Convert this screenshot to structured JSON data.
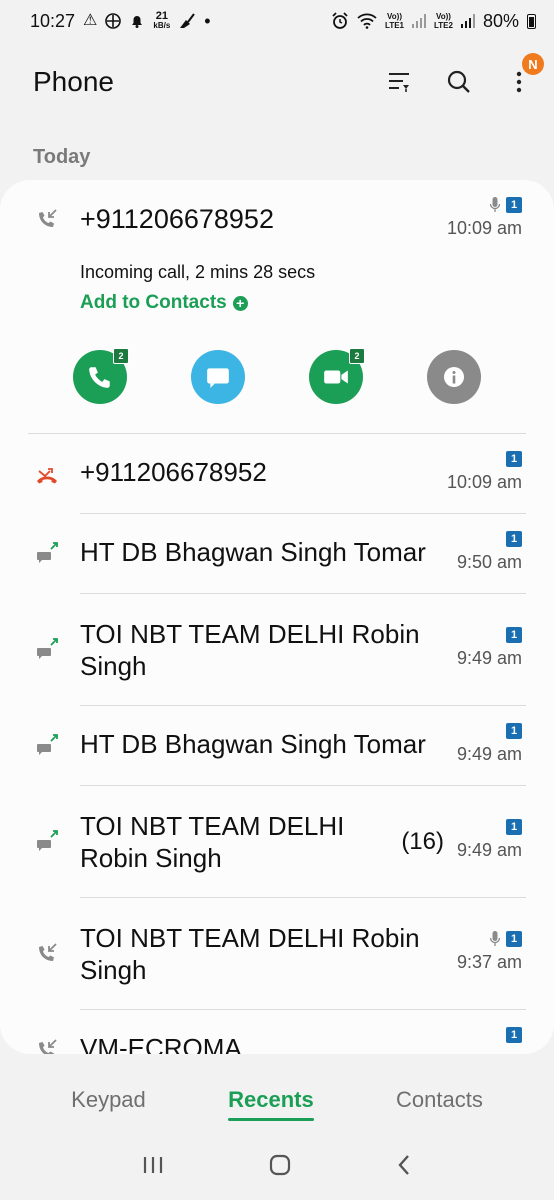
{
  "status_bar": {
    "time": "10:27",
    "net_speed_value": "21",
    "net_speed_unit": "kB/s",
    "dot": "•",
    "volte1_top": "Vo))",
    "volte1_bottom": "LTE1",
    "volte2_top": "Vo))",
    "volte2_bottom": "LTE2",
    "battery": "80%"
  },
  "app_bar": {
    "title": "Phone",
    "menu_badge": "N"
  },
  "section": {
    "label": "Today"
  },
  "expanded_call": {
    "number": "+911206678952",
    "time": "10:09 am",
    "sim": "1",
    "detail": "Incoming call, 2 mins 28 secs",
    "add_to_contacts": "Add to Contacts",
    "actions": {
      "call_count": "2",
      "video_count": "2"
    }
  },
  "calls": [
    {
      "name": "+911206678952",
      "time": "10:09 am",
      "sim": "1",
      "type": "missed"
    },
    {
      "name": "HT DB Bhagwan Singh Tomar",
      "time": "9:50 am",
      "sim": "1",
      "type": "outgoing-message"
    },
    {
      "name": "TOI NBT TEAM DELHI Robin Singh",
      "time": "9:49 am",
      "sim": "1",
      "type": "outgoing-message"
    },
    {
      "name": "HT DB Bhagwan Singh Tomar",
      "time": "9:49 am",
      "sim": "1",
      "type": "outgoing-message"
    },
    {
      "name": "TOI NBT TEAM DELHI Robin Singh",
      "count": "(16)",
      "time": "9:49 am",
      "sim": "1",
      "type": "outgoing-message"
    },
    {
      "name": "TOI NBT TEAM DELHI Robin Singh",
      "time": "9:37 am",
      "sim": "1",
      "type": "incoming"
    },
    {
      "name": "VM-ECROMA",
      "time": "",
      "sim": "1",
      "type": "incoming"
    }
  ],
  "tabs": {
    "keypad": "Keypad",
    "recents": "Recents",
    "contacts": "Contacts"
  },
  "colors": {
    "accent": "#1b9e55",
    "missed": "#e04a2b",
    "sim": "#1a6fb3",
    "message": "#3cb5e5",
    "info": "#8a8a8a"
  }
}
